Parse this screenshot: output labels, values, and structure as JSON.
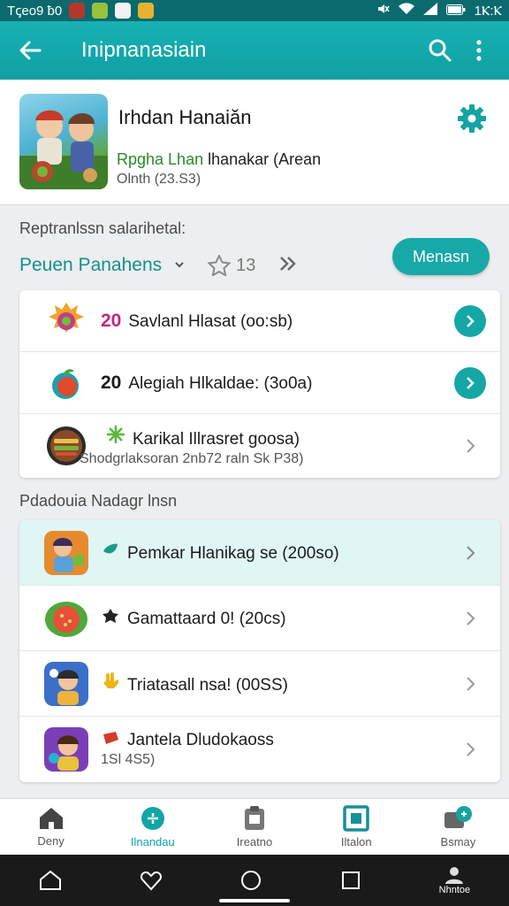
{
  "status_bar": {
    "left_text": "Tꞔeo9 ƀ0",
    "time": "1Ⲕ:Ⲕ"
  },
  "app_bar": {
    "title": "Inipnanasiain"
  },
  "profile": {
    "title": "Irhdan Hanaiăn",
    "line1_green": "Rpgha Lhan",
    "line1_rest": " lhanakar (Arean",
    "line2": "Olnth (23.S3)"
  },
  "section1": {
    "label": "Reptranlssn salarihetal:",
    "filter_label": "Peuen Panahens",
    "rating": "13",
    "pill": "Menasn"
  },
  "list1": [
    {
      "num": "20",
      "text": "Savlanl Hlasat (oo:sb)",
      "action": "go",
      "num_color": "#c2267e"
    },
    {
      "num": "20",
      "text": "Alegiah Hlkaldae: (3o0a)",
      "action": "go",
      "num_color": "#1b1b1b"
    },
    {
      "num": "",
      "text": "Karikal Illrasret goosa)",
      "sub": "Shodgrlaksoran 2nb72 raln Sk P38)",
      "action": "chev"
    }
  ],
  "section2": {
    "label": "Pdadouia Nadagr lnsn"
  },
  "list2": [
    {
      "text": "Pemkar Hlanikag se (200so)",
      "highlight": true
    },
    {
      "text": "Gamattaard 0! (20cs)"
    },
    {
      "text": "Triatasall nsa! (00SS)"
    },
    {
      "text": "Jantela Dludokaoss",
      "sub": "1Sl 4S5)"
    }
  ],
  "bottom_nav": [
    {
      "label": "Deny"
    },
    {
      "label": "Ilnandau"
    },
    {
      "label": "Ireatno"
    },
    {
      "label": "Iltalon"
    },
    {
      "label": "Bsmay"
    }
  ],
  "system_nav": {
    "profile_label": "Nhntoe"
  },
  "colors": {
    "accent": "#17a9a8",
    "status": "#0a6a6d"
  }
}
